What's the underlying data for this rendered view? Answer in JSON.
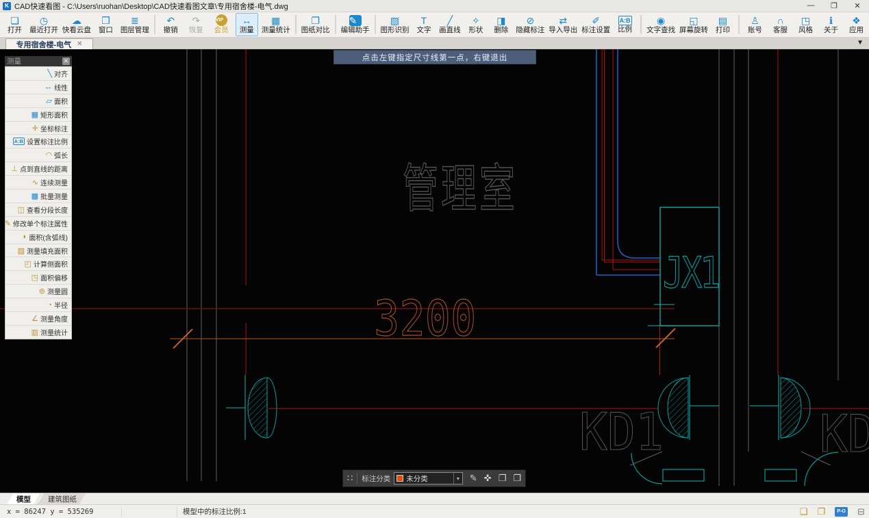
{
  "window": {
    "title": "CAD快速看图 - C:\\Users\\ruohan\\Desktop\\CAD快速看图文章\\专用宿舍楼-电气.dwg",
    "app_icon_glyph": "K",
    "minimize_glyph": "—",
    "restore_glyph": "❐",
    "close_glyph": "✕"
  },
  "toolbar": {
    "items": [
      {
        "name": "open",
        "label": "打开",
        "glyph": "❏"
      },
      {
        "name": "recent-open",
        "label": "最近打开",
        "glyph": "◷"
      },
      {
        "name": "cloud-drive",
        "label": "快看云盘",
        "glyph": "☁"
      },
      {
        "name": "window",
        "label": "窗口",
        "glyph": "❒"
      },
      {
        "name": "layer-manager",
        "label": "图层管理",
        "glyph": "≣"
      },
      {
        "type": "sep"
      },
      {
        "name": "undo",
        "label": "撤销",
        "glyph": "↶"
      },
      {
        "name": "redo",
        "label": "恢复",
        "glyph": "↷",
        "cls": "disabled"
      },
      {
        "name": "vip-member",
        "label": "会员",
        "glyph": "VIP",
        "cls": "vip"
      },
      {
        "name": "measure",
        "label": "测量",
        "glyph": "↔",
        "cls": "active"
      },
      {
        "name": "measure-stats",
        "label": "测量统计",
        "glyph": "▦"
      },
      {
        "type": "sep"
      },
      {
        "name": "drawing-compare",
        "label": "图纸对比",
        "glyph": "❐"
      },
      {
        "type": "sep"
      },
      {
        "name": "edit-assistant",
        "label": "编辑助手",
        "glyph": "✎",
        "cls": "filled"
      },
      {
        "type": "sep"
      },
      {
        "name": "shape-recognition",
        "label": "图形识别",
        "glyph": "▧"
      },
      {
        "name": "text",
        "label": "文字",
        "glyph": "T"
      },
      {
        "name": "draw-line",
        "label": "画直线",
        "glyph": "╱"
      },
      {
        "name": "shapes",
        "label": "形状",
        "glyph": "✧"
      },
      {
        "name": "delete",
        "label": "删除",
        "glyph": "◨"
      },
      {
        "name": "hide-annotations",
        "label": "隐藏标注",
        "glyph": "⊘"
      },
      {
        "name": "import-export",
        "label": "导入导出",
        "glyph": "⇄"
      },
      {
        "name": "annotation-settings",
        "label": "标注设置",
        "glyph": "✐"
      },
      {
        "name": "scale",
        "label": "比例",
        "glyph": "A:B",
        "cls": "chip"
      },
      {
        "type": "sep"
      },
      {
        "name": "text-search",
        "label": "文字查找",
        "glyph": "◉"
      },
      {
        "name": "screen-rotate",
        "label": "屏幕旋转",
        "glyph": "◱"
      },
      {
        "name": "print",
        "label": "打印",
        "glyph": "▤"
      },
      {
        "type": "sep"
      },
      {
        "name": "account",
        "label": "账号",
        "glyph": "♙"
      },
      {
        "name": "support",
        "label": "客服",
        "glyph": "∩"
      },
      {
        "name": "style",
        "label": "风格",
        "glyph": "◳"
      },
      {
        "name": "about",
        "label": "关于",
        "glyph": "ℹ"
      },
      {
        "name": "apps",
        "label": "应用",
        "glyph": "❖"
      }
    ]
  },
  "doc_tab": {
    "label": "专用宿舍楼-电气",
    "close_glyph": "✕",
    "overflow_arrow_glyph": "▼"
  },
  "hint_bar": {
    "text": "点击左键指定尺寸线第一点，右键退出"
  },
  "measure_panel": {
    "title": "测量",
    "close_glyph": "✕",
    "items": [
      {
        "name": "align",
        "label": "对齐",
        "glyph": "╲",
        "cls": "blue"
      },
      {
        "name": "linear",
        "label": "线性",
        "glyph": "↔",
        "cls": "blue"
      },
      {
        "name": "area",
        "label": "面积",
        "glyph": "▱",
        "cls": "blue"
      },
      {
        "name": "rect-area",
        "label": "矩形面积",
        "glyph": "▦",
        "cls": "blue"
      },
      {
        "name": "coordinate-annotation",
        "label": "坐标标注",
        "glyph": "✛"
      },
      {
        "name": "set-annotation-scale",
        "label": "设置标注比例",
        "glyph": "A:B",
        "cls": "blue chip2"
      },
      {
        "name": "arc-length",
        "label": "弧长",
        "glyph": "◠"
      },
      {
        "name": "point-to-line-distance",
        "label": "点到直线的距离",
        "glyph": "⊥"
      },
      {
        "name": "continuous-measure",
        "label": "连续测量",
        "glyph": "∿"
      },
      {
        "name": "batch-measure",
        "label": "批量测量",
        "glyph": "▩",
        "cls": "blue"
      },
      {
        "name": "segment-length",
        "label": "查看分段长度",
        "glyph": "◫"
      },
      {
        "name": "modify-annotation-prop",
        "label": "修改单个标注属性",
        "glyph": "✎"
      },
      {
        "name": "area-with-arc",
        "label": "面积(含弧线)",
        "glyph": "◗"
      },
      {
        "name": "fill-area",
        "label": "测量填充面积",
        "glyph": "▨"
      },
      {
        "name": "side-area",
        "label": "计算侧面积",
        "glyph": "◰"
      },
      {
        "name": "area-offset",
        "label": "面积偏移",
        "glyph": "◳"
      },
      {
        "name": "measure-circle",
        "label": "测量圆",
        "glyph": "⊚"
      },
      {
        "name": "radius",
        "label": "半径",
        "glyph": "◔"
      },
      {
        "name": "measure-angle",
        "label": "测量角度",
        "glyph": "∠"
      },
      {
        "name": "measure-stats",
        "label": "测量统计",
        "glyph": "▥"
      }
    ]
  },
  "drawing": {
    "room_label": "管理室",
    "dimension_value": "3200",
    "junction_box_label": "JX1",
    "cable_label_left": "KD1",
    "cable_label_right": "KD",
    "colors": {
      "wall_gray": "#5f5f5f",
      "cad_text_gray": "#535353",
      "wire_red": "#b01515",
      "dark_red": "#6a1111",
      "dimension_orange": "#b35a1f",
      "dimension_text": "#aa4f2d",
      "conduit_blue": "#1f63c8",
      "symbol_teal": "#0f9b9b",
      "cross_cyan": "#16b2b2"
    }
  },
  "annotation_toolbar": {
    "grid_glyph": "∷",
    "category_label": "标注分类",
    "selected_category": "未分类",
    "swatch_color": "#e2500f",
    "caret_glyph": "▾",
    "edit_glyph": "✎",
    "move_glyph": "✜",
    "copy_glyph": "❐",
    "paste_glyph": "❒"
  },
  "sheet_tabs": [
    {
      "label": "模型",
      "active": true
    },
    {
      "label": "建筑图纸",
      "active": false
    }
  ],
  "status_bar": {
    "coordinates": "x = 86247  y = 535269",
    "scale_text": "模型中的标注比例:1",
    "pdf_icon_glyph": "❏",
    "export_icon_glyph": "❐",
    "po_chip_text": "P-O",
    "window_mode_glyph": "⊟"
  }
}
